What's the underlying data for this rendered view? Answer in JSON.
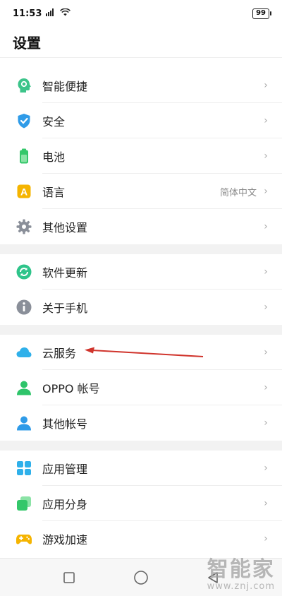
{
  "status_bar": {
    "time": "11:53",
    "signal": "5G",
    "battery": "99"
  },
  "header": {
    "title": "设置"
  },
  "groups": [
    {
      "items": [
        {
          "label": "智能便捷",
          "icon": "smart-assist-icon",
          "color": "#3cc48a"
        },
        {
          "label": "安全",
          "icon": "shield-icon",
          "color": "#2f9be8"
        },
        {
          "label": "电池",
          "icon": "battery-icon",
          "color": "#34c76a"
        },
        {
          "label": "语言",
          "icon": "language-icon",
          "color": "#f5b400",
          "value": "简体中文"
        },
        {
          "label": "其他设置",
          "icon": "gear-icon",
          "color": "#8a8f99"
        }
      ]
    },
    {
      "items": [
        {
          "label": "软件更新",
          "icon": "update-icon",
          "color": "#2ec48a"
        },
        {
          "label": "关于手机",
          "icon": "info-icon",
          "color": "#8a8f99"
        }
      ]
    },
    {
      "items": [
        {
          "label": "云服务",
          "icon": "cloud-icon",
          "color": "#2fb0ea"
        },
        {
          "label": "OPPO 帐号",
          "icon": "account-icon",
          "color": "#2ec46a"
        },
        {
          "label": "其他帐号",
          "icon": "user-icon",
          "color": "#2f9be8"
        }
      ]
    },
    {
      "items": [
        {
          "label": "应用管理",
          "icon": "app-grid-icon",
          "color": "#2fb0ea"
        },
        {
          "label": "应用分身",
          "icon": "app-clone-icon",
          "color": "#34c76a"
        },
        {
          "label": "游戏加速",
          "icon": "gamepad-icon",
          "color": "#f5b400"
        }
      ]
    }
  ],
  "annotation": {
    "color": "#d0342c"
  },
  "watermark": {
    "title": "智能家",
    "url": "www.znj.com"
  }
}
